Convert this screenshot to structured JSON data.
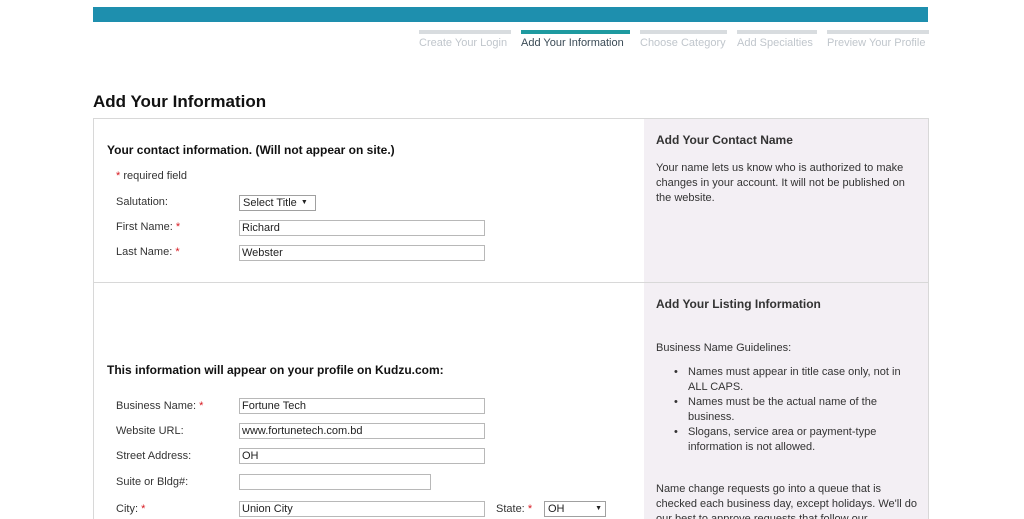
{
  "steps": [
    {
      "label": "Create Your Login",
      "active": false
    },
    {
      "label": "Add Your Information",
      "active": true
    },
    {
      "label": "Choose Category",
      "active": false
    },
    {
      "label": "Add Specialties",
      "active": false
    },
    {
      "label": "Preview Your Profile",
      "active": false
    }
  ],
  "page_title": "Add Your Information",
  "contact": {
    "heading": "Your contact information. (Will not appear on site.)",
    "required_note": "required field",
    "salutation_label": "Salutation:",
    "salutation_value": "Select Title",
    "first_name_label": "First Name:",
    "first_name_value": "Richard",
    "last_name_label": "Last Name:",
    "last_name_value": "Webster"
  },
  "contact_side": {
    "heading": "Add Your Contact Name",
    "text": "Your name lets us know who is authorized to make changes in your account. It will not be published on the website."
  },
  "listing": {
    "heading": "This information will appear on your profile on Kudzu.com:",
    "business_name_label": "Business Name:",
    "business_name_value": "Fortune Tech",
    "website_label": "Website URL:",
    "website_value": "www.fortunetech.com.bd",
    "street_label": "Street Address:",
    "street_value": "OH",
    "suite_label": "Suite or Bldg#:",
    "suite_value": "",
    "city_label": "City:",
    "city_value": "Union City",
    "state_label": "State:",
    "state_value": "OH"
  },
  "listing_side": {
    "heading": "Add Your Listing Information",
    "guidelines_title": "Business Name Guidelines:",
    "guidelines": [
      "Names must appear in title case only, not in ALL CAPS.",
      "Names must be the actual name of the business.",
      "Slogans, service area or payment-type information is not allowed."
    ],
    "change_text": "Name change requests go into a queue that is checked each business day, except holidays. We'll do our best to approve requests that follow our"
  },
  "colors": {
    "brand_bar": "#1e8fae",
    "active_step": "#1e9aa0",
    "required_star": "#d71920",
    "side_panel": "#f3eff4"
  }
}
